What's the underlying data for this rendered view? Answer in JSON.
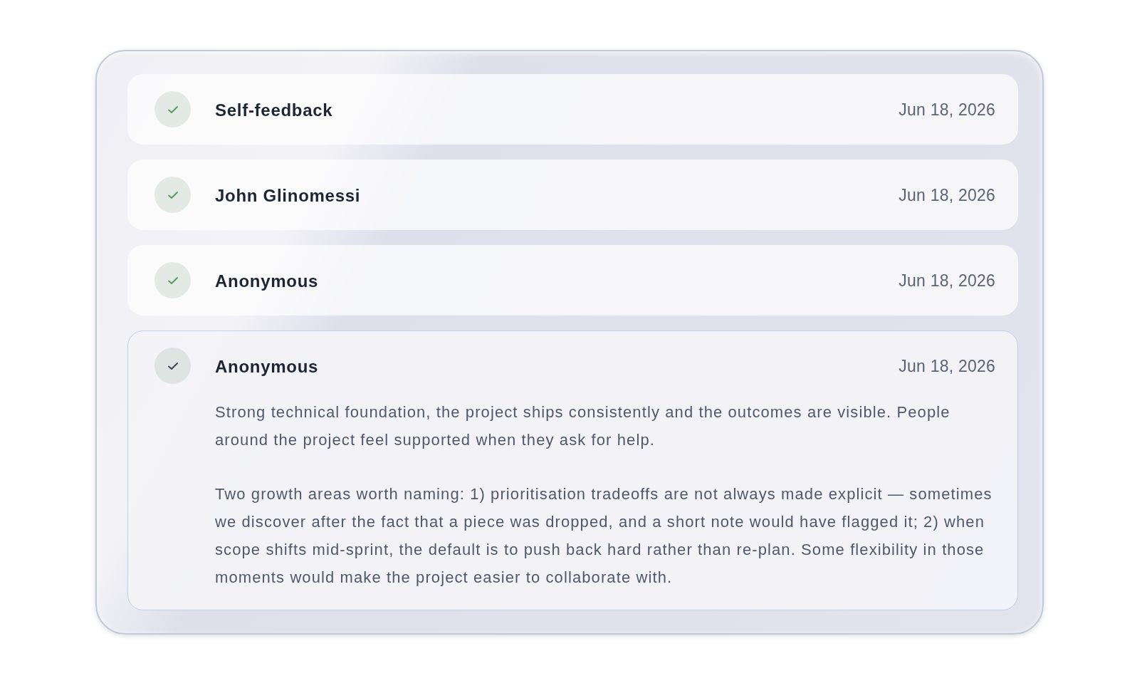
{
  "feedback_entries": [
    {
      "name": "Self-feedback",
      "date": "Jun 18, 2026",
      "completed": true,
      "expanded": false
    },
    {
      "name": "John Glinomessi",
      "date": "Jun 18, 2026",
      "completed": true,
      "expanded": false
    },
    {
      "name": "Anonymous",
      "date": "Jun 18, 2026",
      "completed": true,
      "expanded": false
    },
    {
      "name": "Anonymous",
      "date": "Jun 18, 2026",
      "completed": true,
      "expanded": true,
      "comment_paragraphs": [
        "Strong technical foundation, the project ships consistently and the outcomes are visible. People around the project feel supported when they ask for help.",
        "Two growth areas worth naming: 1) prioritisation tradeoffs are not always made explicit — sometimes we discover after the fact that a piece was dropped, and a short note would have flagged it; 2) when scope shifts mid-sprint, the default is to push back hard rather than re-plan. Some flexibility in those moments would make the project easier to collaborate with."
      ]
    }
  ]
}
